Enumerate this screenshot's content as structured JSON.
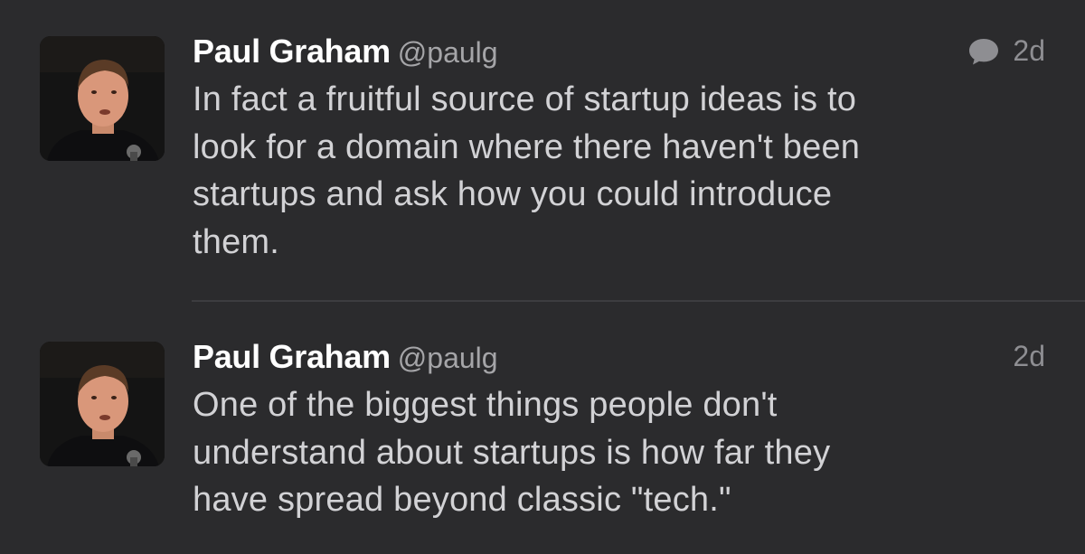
{
  "tweets": [
    {
      "author_name": "Paul Graham",
      "author_handle": "@paulg",
      "time": "2d",
      "has_reply_icon": true,
      "text_lines": [
        "In fact a fruitful source of startup ideas is to",
        "look for a domain where there haven't been",
        "startups and ask how you could introduce",
        "them."
      ]
    },
    {
      "author_name": "Paul Graham",
      "author_handle": "@paulg",
      "time": "2d",
      "has_reply_icon": false,
      "text_lines": [
        "One of the biggest things people don't",
        "understand about startups is how far they",
        "have spread beyond classic \"tech.\""
      ]
    }
  ],
  "icons": {
    "reply": "speech-bubble-icon",
    "avatar": "profile-photo"
  },
  "colors": {
    "background": "#2b2b2d",
    "name": "#ffffff",
    "handle": "#a5a5a8",
    "body_text": "#d2d2d5",
    "meta": "#8e8e92",
    "divider": "#3d3d40"
  }
}
